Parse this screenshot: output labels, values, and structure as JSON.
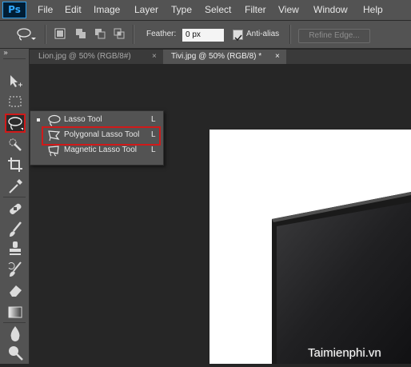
{
  "app": {
    "logo_text": "Ps"
  },
  "menu": {
    "items": [
      "File",
      "Edit",
      "Image",
      "Layer",
      "Type",
      "Select",
      "Filter",
      "View",
      "Window",
      "Help"
    ]
  },
  "options": {
    "feather_label": "Feather:",
    "feather_value": "0 px",
    "antialias_label": "Anti-alias",
    "antialias_checked": true,
    "refine_edge_label": "Refine Edge..."
  },
  "tabs": [
    {
      "title": "Lion.jpg @ 50% (RGB/8#)",
      "close": "×",
      "active": false
    },
    {
      "title": "Tivi.jpg @ 50% (RGB/8) *",
      "close": "×",
      "active": true
    }
  ],
  "toolbar": {
    "collapse_glyph": "»"
  },
  "lasso_flyout": {
    "items": [
      {
        "label": "Lasso Tool",
        "key": "L",
        "current": true,
        "icon": "lasso-icon"
      },
      {
        "label": "Polygonal Lasso Tool",
        "key": "L",
        "current": false,
        "icon": "polygonal-lasso-icon",
        "highlighted": true
      },
      {
        "label": "Magnetic Lasso Tool",
        "key": "L",
        "current": false,
        "icon": "magnetic-lasso-icon"
      }
    ]
  },
  "watermark": "Taimienphi.vn",
  "colors": {
    "highlight": "#d01a1a",
    "ps_blue": "#31a8ff"
  }
}
